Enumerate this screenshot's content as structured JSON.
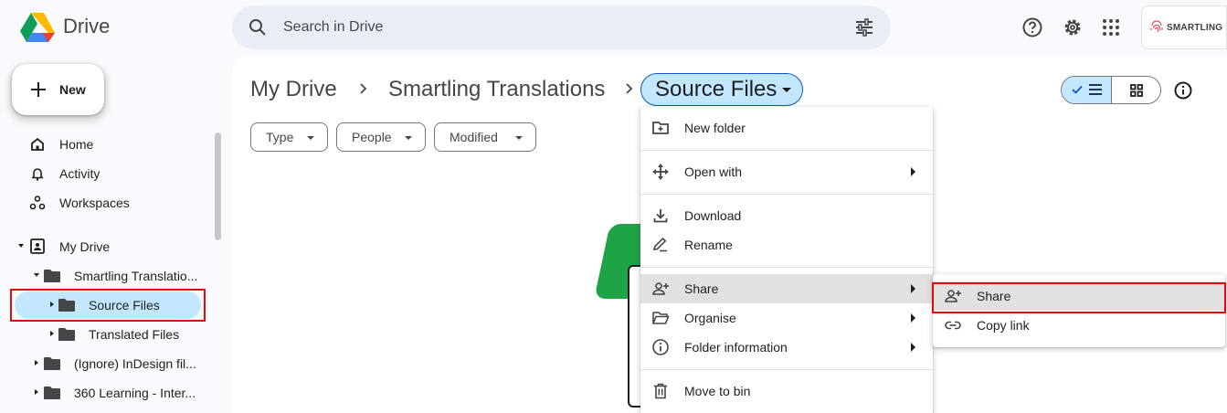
{
  "app": {
    "name": "Drive"
  },
  "search": {
    "placeholder": "Search in Drive"
  },
  "brand": {
    "name": "SMARTLING"
  },
  "sidebar": {
    "new_label": "New",
    "nav": [
      {
        "label": "Home",
        "icon": "home-icon"
      },
      {
        "label": "Activity",
        "icon": "bell-icon"
      },
      {
        "label": "Workspaces",
        "icon": "workspaces-icon"
      }
    ],
    "tree": [
      {
        "label": "My Drive"
      },
      {
        "label": "Smartling Translatio..."
      },
      {
        "label": "Source Files"
      },
      {
        "label": "Translated Files"
      },
      {
        "label": "(Ignore) InDesign fil..."
      },
      {
        "label": "360 Learning - Inter..."
      }
    ]
  },
  "breadcrumb": {
    "items": [
      "My Drive",
      "Smartling Translations"
    ],
    "current": "Source Files"
  },
  "filters": [
    "Type",
    "People",
    "Modified"
  ],
  "context_menu": {
    "items": [
      {
        "label": "New folder",
        "icon": "new-folder-icon"
      },
      {
        "label": "Open with",
        "icon": "open-with-icon",
        "submenu": true
      },
      {
        "label": "Download",
        "icon": "download-icon"
      },
      {
        "label": "Rename",
        "icon": "rename-icon"
      },
      {
        "label": "Share",
        "icon": "share-icon",
        "submenu": true,
        "highlighted": true
      },
      {
        "label": "Organise",
        "icon": "organise-icon",
        "submenu": true
      },
      {
        "label": "Folder information",
        "icon": "info-icon",
        "submenu": true
      },
      {
        "label": "Move to bin",
        "icon": "bin-icon"
      }
    ]
  },
  "share_submenu": {
    "items": [
      {
        "label": "Share",
        "icon": "share-icon",
        "highlighted": true
      },
      {
        "label": "Copy link",
        "icon": "link-icon"
      }
    ]
  },
  "colors": {
    "accent": "#0b57d0",
    "selected": "#c2e7ff",
    "annotation": "#e30b0b"
  }
}
